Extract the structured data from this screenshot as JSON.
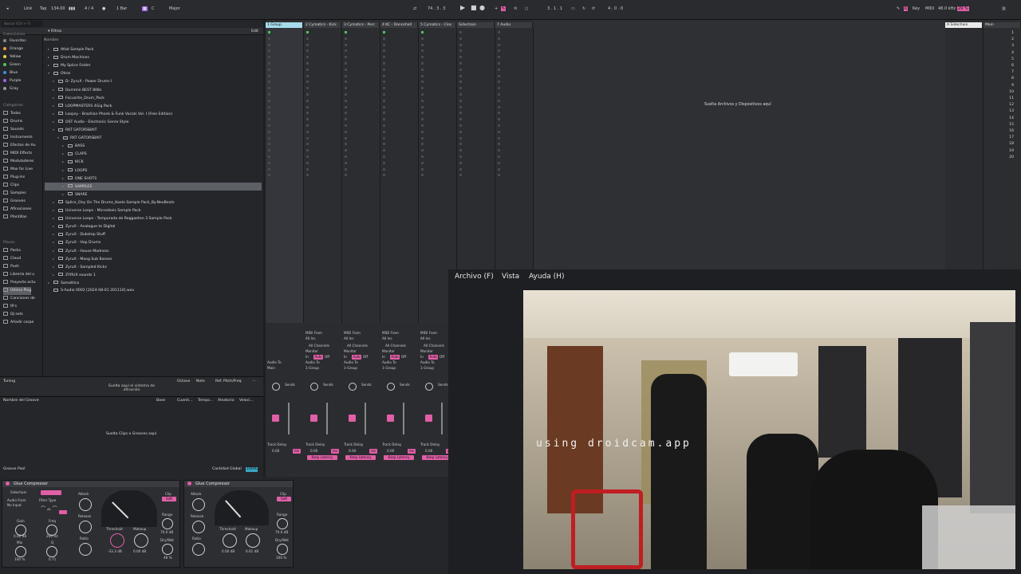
{
  "topbar": {
    "link": "Link",
    "tap": "Tap",
    "bpm": "134.00",
    "sig": "4 / 4",
    "bar": "1 Bar",
    "key": "C",
    "scale": "Major",
    "position": "74 . 3 . 3",
    "loop": "3 . 1 . 1",
    "length": "4 . 0 . 0",
    "keylabel": "Key",
    "midi": "MIDI",
    "samplerate": "48.0 kHz",
    "cpu": "29 %"
  },
  "browser": {
    "search_placeholder": "Buscar (Ctrl + F)",
    "filter": "Filtros",
    "edit": "Edit",
    "col_name": "Nombre",
    "sections": {
      "collections": "Colecciones",
      "categories": "Categorías",
      "places": "Places"
    },
    "collections": [
      {
        "label": "Favoritos",
        "color": "#888888"
      },
      {
        "label": "Orange",
        "color": "#f39c3c"
      },
      {
        "label": "Yellow",
        "color": "#e8d34a"
      },
      {
        "label": "Green",
        "color": "#4fc35a"
      },
      {
        "label": "Blue",
        "color": "#3d8fe0"
      },
      {
        "label": "Purple",
        "color": "#a067e0"
      },
      {
        "label": "Gray",
        "color": "#9a9a9a"
      }
    ],
    "categories": [
      "Todos",
      "Drums",
      "Sounds",
      "Instruments",
      "Efectos de Au",
      "MIDI Effects",
      "Moduladores",
      "Max for Live",
      "Plug-ins",
      "Clips",
      "Samples",
      "Grooves",
      "Afinaciones",
      "Plantillas"
    ],
    "places": [
      "Packs",
      "Cloud",
      "Push",
      "Librería del u",
      "Proyecto actu",
      "Ultima Plug",
      "Canciones de",
      "IR's",
      "DJ sets",
      "Añadir carpe"
    ],
    "tree": [
      "Atlat Sample Pack",
      "Drum Machines",
      "My Splice Folder",
      "Otros",
      "D- ZyruX - Power Drums I",
      "Dummie BEST 808s",
      "Focusrite_Drum_Pack",
      "LOOPMASTERS 4Gig Pack",
      "Loopsy - Brazilian Phonk & Funk Vocals Vol. I (Free Edition)",
      "OST Audio - Electronic Genre Style",
      "RKT GATORSBAIT",
      "RKT GATORSBAIT",
      "BASS",
      "CLAPS",
      "KICK",
      "LOOPS",
      "ONE SHOTS",
      "SAMPLES",
      "SNARE",
      "Splice_Ony On The Drums_Kaelo Sample Pack_By.NeoBeats",
      "Universe Loops - Microdosis Sample Pack",
      "Universe Loops - Temporada de Reggaeton 3 Sample Pack",
      "ZyruX - Analogue to Digital",
      "ZyruX - Dubstep Stuff",
      "ZyruX - Hop Drums",
      "ZyruX - House Madness",
      "ZyruX - Moog Sub Basses",
      "ZyruX - Sampled Kicks",
      "ZYRUX sounds 1",
      "Samattica",
      "S-Audio 0002 [2024-08-01 201110].wav"
    ],
    "tuning": {
      "label": "Tuning",
      "drop": "Suelta aquí el sistema de afinación",
      "octave": "Octave",
      "note": "Note",
      "ref": "Ref. Pitch/Freq"
    },
    "groove": {
      "col_name": "Nombre del Groove",
      "base": "Base",
      "quant": "Cuanti...",
      "timing": "Tempo...",
      "random": "Aleatorio",
      "vel": "Veloci...",
      "drop": "Suelta Clips o Grooves aquí",
      "pool": "Groove Pool",
      "global": "Cantidad Global",
      "global_val": "100%"
    }
  },
  "session": {
    "tracks": [
      "1 Group",
      "2 Cymatics - Kick",
      "3 Cymatics - Perc",
      "4 KC - Dancehall",
      "5 Cymatics - Clos",
      "Sidechain",
      "7 Audio"
    ],
    "return": "A Sidechain",
    "master": "Main",
    "drop": "Suelta Archivos y Dispositivos aquí",
    "midi_from": "MIDI From",
    "all_ins": "All Ins",
    "all_channels": "All Channels",
    "monitor": "Monitor",
    "in": "In",
    "auto": "Auto",
    "off": "Off",
    "audio_to": "Audio To",
    "main": "Main",
    "group": "1-Group",
    "sends": "Sends",
    "track_delay": "Track Delay",
    "delay_val": "0.00",
    "ms": "ms",
    "keep_latency": "Keep Latency",
    "scene_numbers": [
      "1",
      "2",
      "3",
      "4",
      "5",
      "6",
      "7",
      "8",
      "9",
      "10",
      "11",
      "12",
      "13",
      "14",
      "15",
      "16",
      "17",
      "18",
      "19",
      "20"
    ]
  },
  "devices": [
    {
      "name": "Glue Compressor",
      "sidechain": "Sidechain",
      "audio_from": "Audio From",
      "no_input": "No Input",
      "filter": "Filter Type",
      "gain": "Gain",
      "gain_val": "0.00 dB",
      "mix": "Mix",
      "mix_val": "100 %",
      "freq": "Freq",
      "freq_val": "200 Hz",
      "q": "Q",
      "q_val": "0.71",
      "attack": "Attack",
      "release": "Release",
      "ratio": "Ratio",
      "threshold": "Threshold",
      "thr_val": "-33.3 dB",
      "makeup": "Makeup",
      "mk_val": "0.00 dB",
      "clip": "Clip",
      "soft": "Soft",
      "range": "Range",
      "range_val": "70.0 dB",
      "drywet": "Dry/Wet",
      "dw_val": "48 %"
    },
    {
      "name": "Glue Compressor",
      "attack": "Attack",
      "release": "Release",
      "ratio": "Ratio",
      "threshold": "Threshold",
      "thr_val": "0.00 dB",
      "makeup": "Makeup",
      "mk_val": "6.61 dB",
      "clip": "Clip",
      "soft": "Soft",
      "range": "Range",
      "range_val": "70.0 dB",
      "drywet": "Dry/Wet",
      "dw_val": "100 %"
    }
  ],
  "menu": {
    "file": "Archivo (F)",
    "view": "Vista",
    "help": "Ayuda (H)"
  },
  "webcam": {
    "watermark": "using droidcam.app"
  }
}
